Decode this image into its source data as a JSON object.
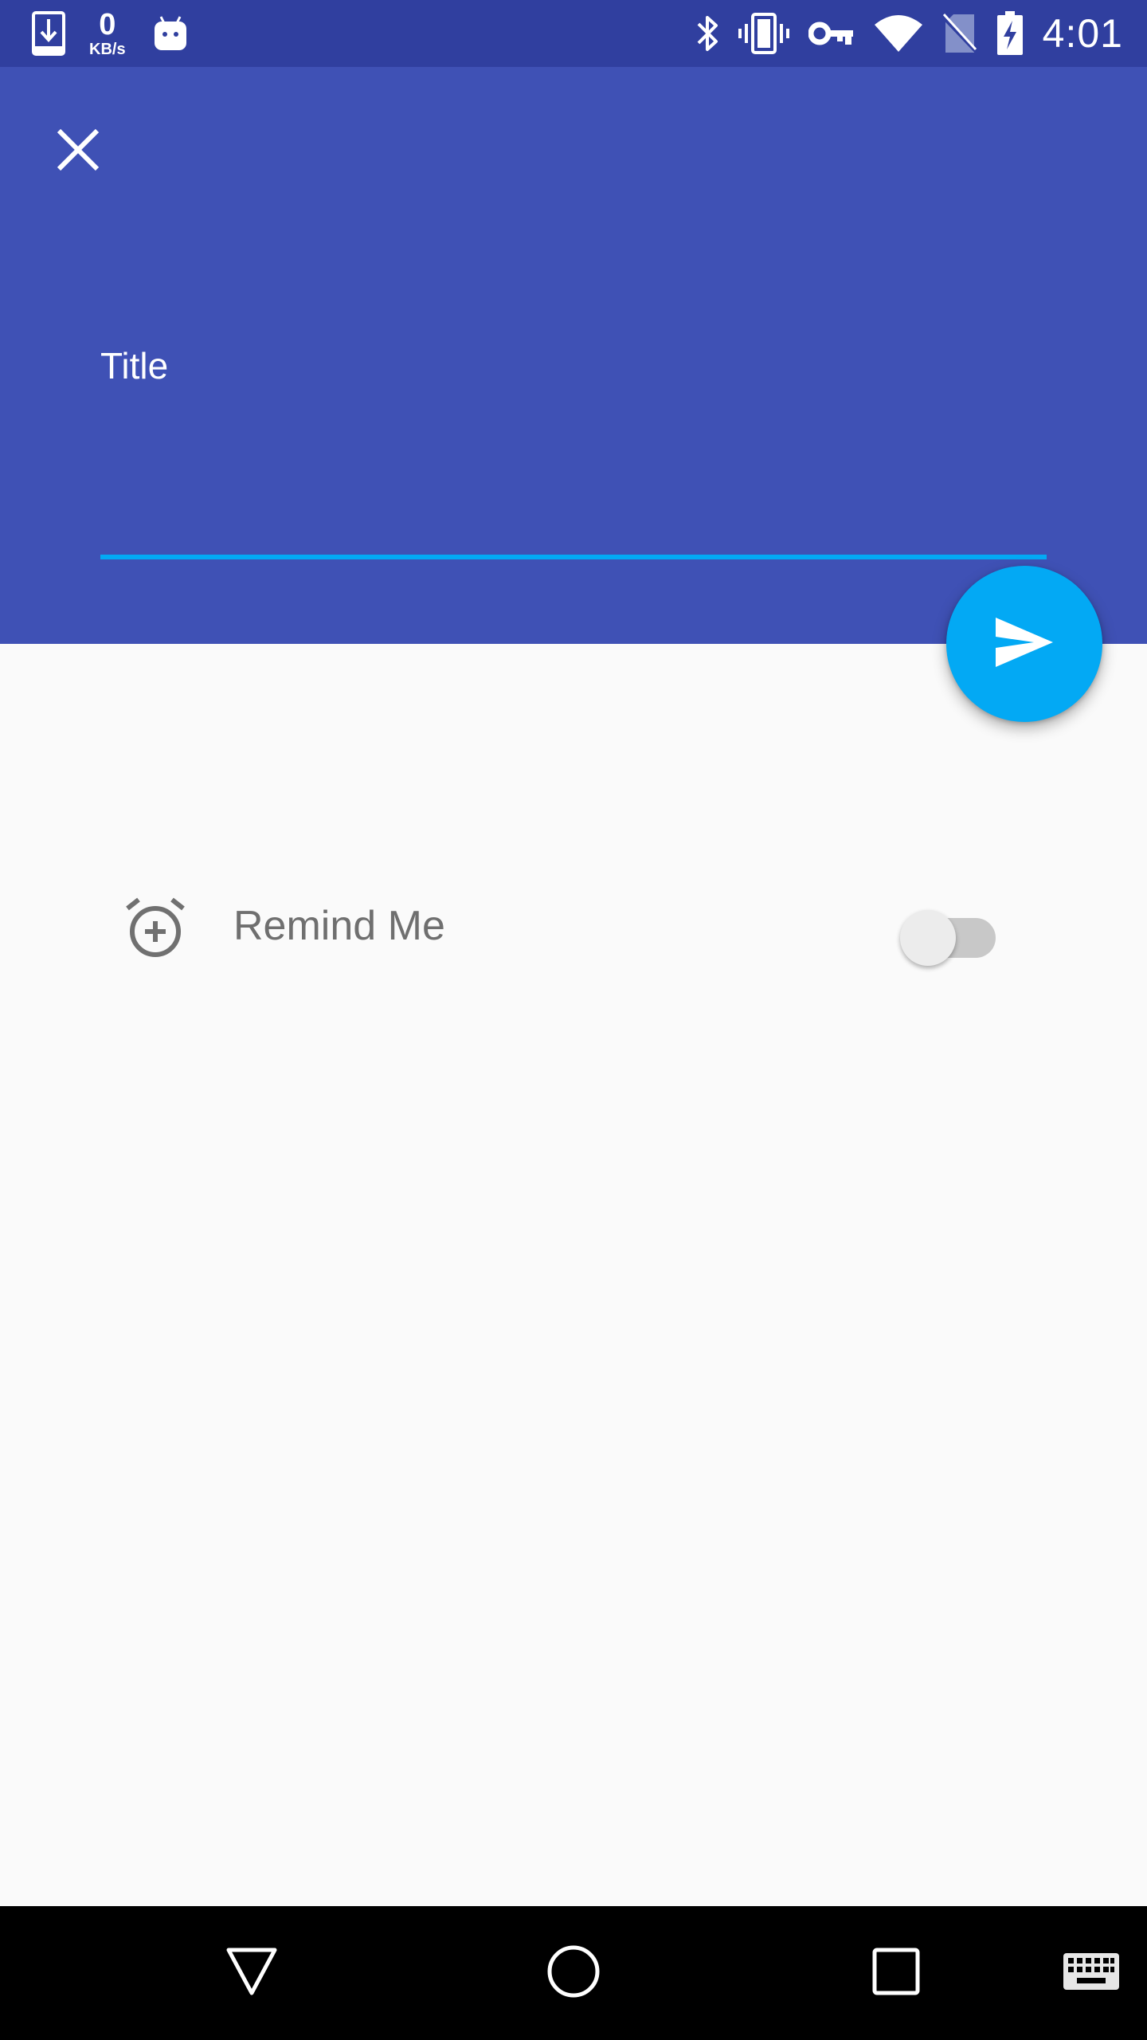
{
  "status_bar": {
    "network_speed_value": "0",
    "network_speed_unit": "KB/s",
    "time": "4:01",
    "left_icons": [
      "download-icon",
      "android-icon"
    ],
    "right_icons": [
      "bluetooth-icon",
      "vibrate-icon",
      "vpn-key-icon",
      "wifi-icon",
      "no-sim-icon",
      "battery-charging-icon"
    ]
  },
  "header": {
    "close_icon": "close-icon",
    "title_field": {
      "label": "Title",
      "value": "",
      "placeholder": ""
    }
  },
  "fab": {
    "icon": "send-icon"
  },
  "reminder": {
    "icon": "alarm-add-icon",
    "label": "Remind Me",
    "enabled": false
  },
  "nav_bar": {
    "buttons": [
      "back-icon",
      "home-icon",
      "recents-icon",
      "keyboard-icon"
    ]
  },
  "colors": {
    "status_bar": "#303f9f",
    "header": "#3f51b5",
    "accent": "#03a9f4",
    "background": "#fafafa",
    "nav_bar": "#000000"
  }
}
